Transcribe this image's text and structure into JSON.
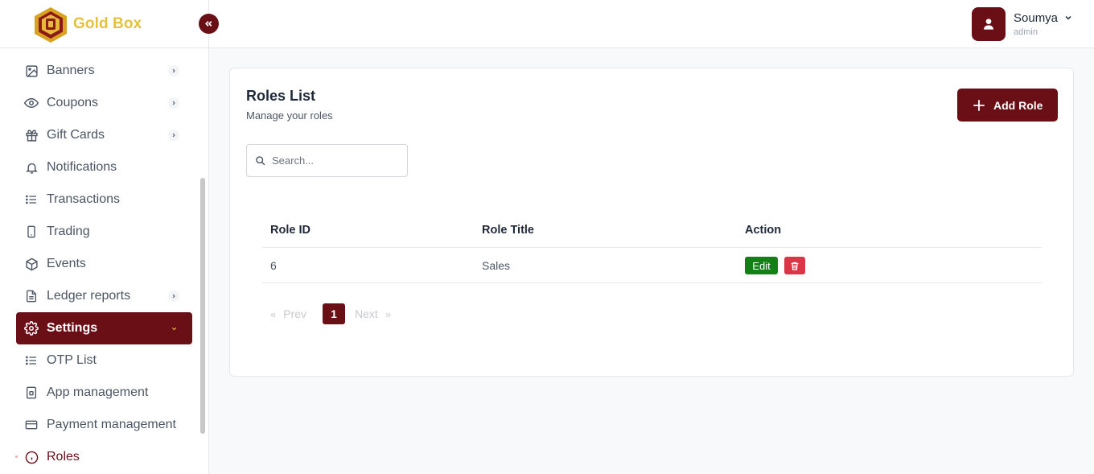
{
  "brand": {
    "name": "Gold Box"
  },
  "sidebar": {
    "items": [
      {
        "label": "Banners",
        "icon": "image-icon",
        "has_chevron": true
      },
      {
        "label": "Coupons",
        "icon": "eye-icon",
        "has_chevron": true
      },
      {
        "label": "Gift Cards",
        "icon": "gift-icon",
        "has_chevron": true
      },
      {
        "label": "Notifications",
        "icon": "bell-icon",
        "has_chevron": false
      },
      {
        "label": "Transactions",
        "icon": "list-icon",
        "has_chevron": false
      },
      {
        "label": "Trading",
        "icon": "phone-icon",
        "has_chevron": false
      },
      {
        "label": "Events",
        "icon": "cube-icon",
        "has_chevron": false
      },
      {
        "label": "Ledger reports",
        "icon": "document-icon",
        "has_chevron": true
      },
      {
        "label": "Settings",
        "icon": "gear-icon",
        "has_chevron": true,
        "active": true
      },
      {
        "label": "OTP List",
        "icon": "list-icon",
        "has_chevron": false
      },
      {
        "label": "App management",
        "icon": "device-icon",
        "has_chevron": false
      },
      {
        "label": "Payment management",
        "icon": "credit-card-icon",
        "has_chevron": false
      },
      {
        "label": "Roles",
        "icon": "info-icon",
        "has_chevron": false,
        "current": true
      }
    ]
  },
  "header": {
    "user_name": "Soumya",
    "user_role": "admin"
  },
  "main": {
    "title": "Roles List",
    "subtitle": "Manage your roles",
    "add_button_label": "Add Role",
    "search_placeholder": "Search...",
    "table": {
      "columns": [
        "Role ID",
        "Role Title",
        "Action"
      ],
      "rows": [
        {
          "id": "6",
          "title": "Sales",
          "edit_label": "Edit"
        }
      ]
    },
    "pagination": {
      "prev_label": "Prev",
      "next_label": "Next",
      "prev_arrow": "«",
      "next_arrow": "»",
      "current_page": "1"
    }
  },
  "colors": {
    "brand": "#6b0f16",
    "gold": "#e6c13c",
    "edit": "#128015",
    "delete": "#dc3545"
  }
}
